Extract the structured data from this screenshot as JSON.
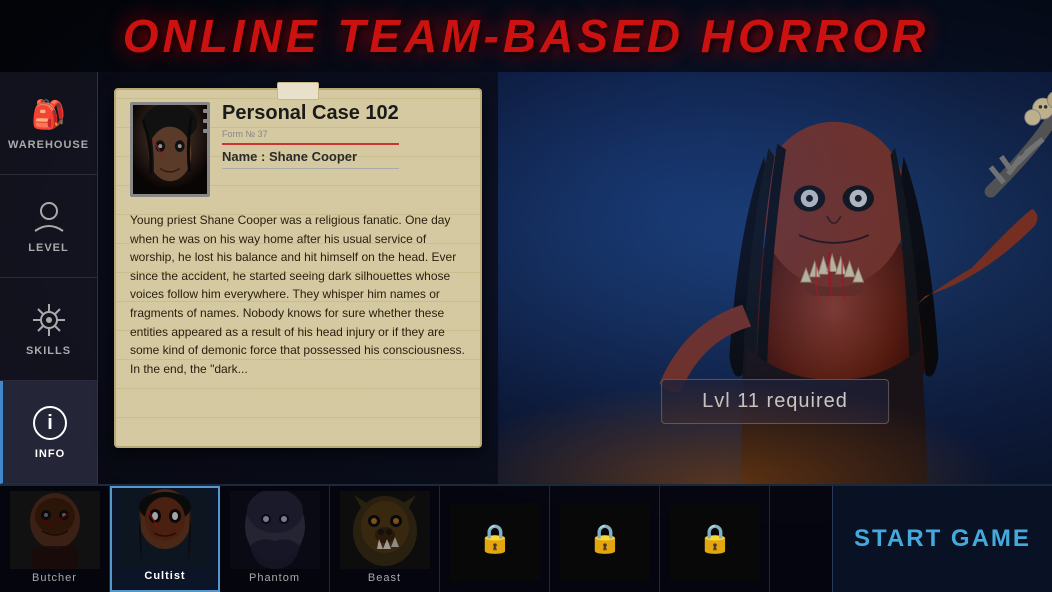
{
  "title": "ONLINE TEAM-BASED HORROR",
  "sidebar": {
    "items": [
      {
        "id": "warehouse",
        "label": "Warehouse",
        "icon": "🎒"
      },
      {
        "id": "level",
        "label": "Level",
        "icon": "👤"
      },
      {
        "id": "skills",
        "label": "Skills",
        "icon": "⚙️"
      },
      {
        "id": "info",
        "label": "Info",
        "icon": "ℹ️",
        "active": true
      }
    ]
  },
  "case_card": {
    "title": "Personal Case 102",
    "form_num": "Form № 37",
    "name_label": "Name : Shane Cooper",
    "body_text": "Young priest Shane Cooper was a religious fanatic. One day when he was on his way home after his usual service of worship, he lost his balance and hit himself on the head. Ever since the accident, he started seeing dark silhouettes whose voices follow him everywhere. They whisper him names or fragments of names. Nobody knows for sure whether these entities appeared as a result of his head injury or if they are some kind of demonic force that possessed his consciousness. In the end, the \"dark..."
  },
  "monster": {
    "lvl_required": "Lvl 11 required"
  },
  "bottom_bar": {
    "characters": [
      {
        "id": "butcher",
        "label": "Butcher",
        "active": false,
        "icon": "💀"
      },
      {
        "id": "cultist",
        "label": "Cultist",
        "active": true,
        "icon": "🧟"
      },
      {
        "id": "phantom",
        "label": "Phantom",
        "active": false,
        "icon": "👻"
      },
      {
        "id": "beast",
        "label": "Beast",
        "active": false,
        "icon": "🐺"
      },
      {
        "id": "locked1",
        "label": "",
        "active": false,
        "icon": "🔒"
      },
      {
        "id": "locked2",
        "label": "",
        "active": false,
        "icon": "🔒"
      },
      {
        "id": "locked3",
        "label": "",
        "active": false,
        "icon": "🔒"
      }
    ],
    "start_button_label": "START GAME"
  }
}
